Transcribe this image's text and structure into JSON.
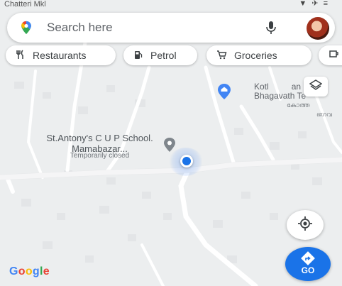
{
  "status": {
    "top_label": "Chatteri Mkl",
    "icons": "▼ ✈ ≡"
  },
  "search": {
    "placeholder": "Search here",
    "pin_icon": "maps-pin-icon",
    "mic_icon": "mic-icon",
    "avatar": "profile-avatar"
  },
  "chips": [
    {
      "label": "Restaurants",
      "icon": "restaurant-icon",
      "glyph": "¥¥"
    },
    {
      "label": "Petrol",
      "icon": "fuel-icon",
      "glyph": "⛽"
    },
    {
      "label": "Groceries",
      "icon": "cart-icon",
      "glyph": "🛒"
    },
    {
      "label": "",
      "icon": "coffee-icon",
      "glyph": "☕"
    }
  ],
  "map": {
    "poi": {
      "name": "St.Antony's C U P School. Mamabazar...",
      "status": "Temporarily closed"
    },
    "koth": {
      "line1": "Kotl",
      "line1b": "an",
      "line2": "Bhagavath Te",
      "line3": "കോത്ത",
      "line4": "ഭഗവ"
    }
  },
  "buttons": {
    "layers_icon": "layers-icon",
    "my_location_icon": "my-location-icon",
    "go_label": "GO"
  },
  "brand": {
    "google": [
      "G",
      "o",
      "o",
      "g",
      "l",
      "e"
    ],
    "colors": [
      "#4285F4",
      "#EA4335",
      "#FBBC05",
      "#4285F4",
      "#34A853",
      "#EA4335"
    ]
  },
  "colors": {
    "accent": "#1a73e8",
    "map_bg": "#eceeef",
    "road": "#ffffff"
  }
}
